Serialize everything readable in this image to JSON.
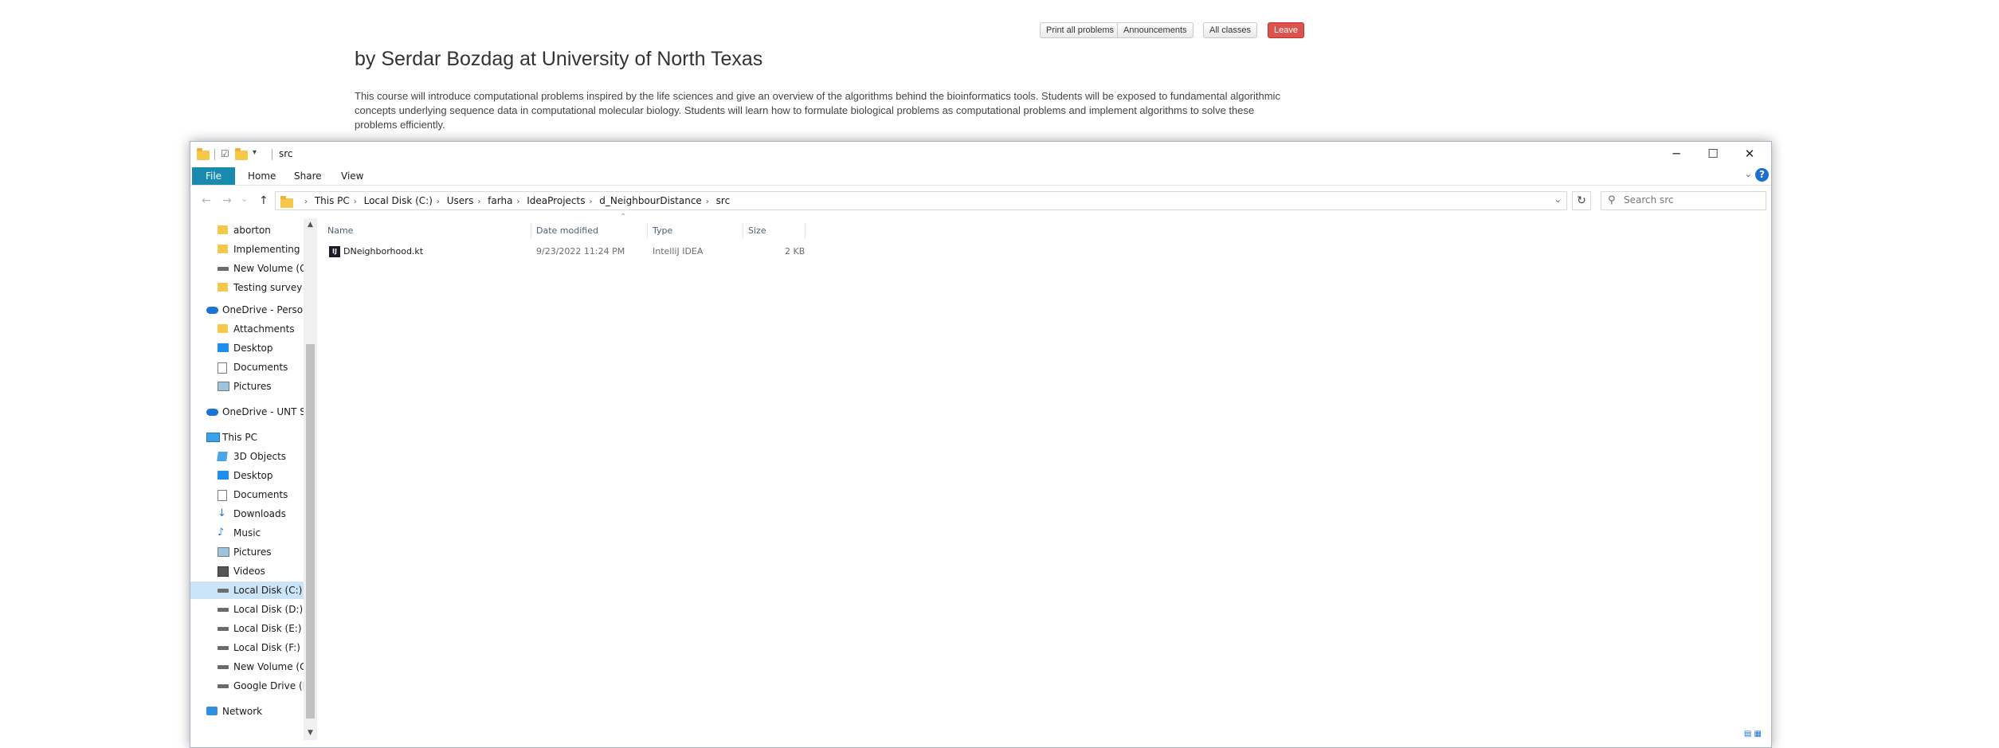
{
  "page": {
    "buttons": [
      "Print all problems",
      "Announcements",
      "All classes",
      "Leave"
    ],
    "title": "by Serdar Bozdag at University of North Texas",
    "description": "This course will introduce computational problems inspired by the life sciences and give an overview of the algorithms behind the bioinformatics tools. Students will be exposed to fundamental algorithmic concepts underlying sequence data in computational molecular biology. Students will learn how to formulate biological problems as computational problems and implement algorithms to solve these problems efficiently."
  },
  "explorer": {
    "window_title": "src",
    "window_controls": {
      "minimize": "─",
      "maximize": "☐",
      "close": "✕"
    },
    "ribbon_tabs": [
      "File",
      "Home",
      "Share",
      "View"
    ],
    "help": "?",
    "nav_arrows": {
      "back": "←",
      "forward": "→",
      "recent": "⌄",
      "up": "↑"
    },
    "breadcrumb": [
      "This PC",
      "Local Disk (C:)",
      "Users",
      "farha",
      "IdeaProjects",
      "d_NeighbourDistance",
      "src"
    ],
    "search_placeholder": "Search src",
    "nav_items": [
      {
        "label": "aborton",
        "icon": "folder-icon"
      },
      {
        "label": "Implementing Lo",
        "icon": "folder-icon"
      },
      {
        "label": "New Volume (G:",
        "icon": "drive-icon"
      },
      {
        "label": "Testing survey of",
        "icon": "folder-icon"
      },
      {
        "label": "OneDrive - Person",
        "icon": "onedrive-icon"
      },
      {
        "label": "Attachments",
        "icon": "folder-icon"
      },
      {
        "label": "Desktop",
        "icon": "desktop-icon"
      },
      {
        "label": "Documents",
        "icon": "documents-icon"
      },
      {
        "label": "Pictures",
        "icon": "pictures-icon"
      },
      {
        "label": "OneDrive - UNT Sy",
        "icon": "onedrive-icon"
      },
      {
        "label": "This PC",
        "icon": "this-pc-icon"
      },
      {
        "label": "3D Objects",
        "icon": "3d-objects-icon"
      },
      {
        "label": "Desktop",
        "icon": "desktop-icon"
      },
      {
        "label": "Documents",
        "icon": "documents-icon"
      },
      {
        "label": "Downloads",
        "icon": "downloads-icon"
      },
      {
        "label": "Music",
        "icon": "music-icon"
      },
      {
        "label": "Pictures",
        "icon": "pictures-icon"
      },
      {
        "label": "Videos",
        "icon": "videos-icon"
      },
      {
        "label": "Local Disk (C:)",
        "icon": "drive-icon",
        "selected": true
      },
      {
        "label": "Local Disk (D:)",
        "icon": "drive-icon"
      },
      {
        "label": "Local Disk (E:)",
        "icon": "drive-icon"
      },
      {
        "label": "Local Disk (F:)",
        "icon": "drive-icon"
      },
      {
        "label": "New Volume (G:",
        "icon": "drive-icon"
      },
      {
        "label": "Google Drive (H:",
        "icon": "drive-icon"
      },
      {
        "label": "Network",
        "icon": "network-icon"
      }
    ],
    "columns": [
      "Name",
      "Date modified",
      "Type",
      "Size"
    ],
    "files": [
      {
        "name": "DNeighborhood.kt",
        "date_modified": "9/23/2022 11:24 PM",
        "type": "IntelliJ IDEA",
        "size": "2 KB",
        "icon": "intellij-file-icon"
      }
    ]
  },
  "colors": {
    "file_tab": "#1a8ab0",
    "selected_nav": "#cce4f7",
    "leave_button": "#d9534f"
  }
}
